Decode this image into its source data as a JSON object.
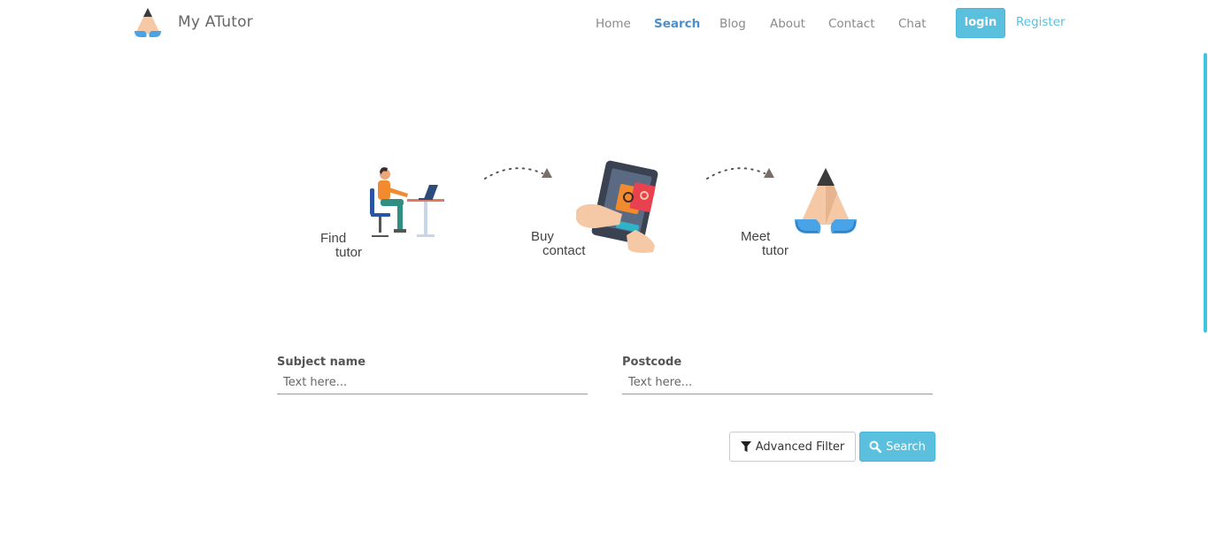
{
  "brand": {
    "name": "My ATutor",
    "logo_icon": "atutor-pencil-logo-icon"
  },
  "nav": {
    "items": [
      {
        "label": "Home",
        "active": false
      },
      {
        "label": "Search",
        "active": true
      },
      {
        "label": "Blog",
        "active": false
      },
      {
        "label": "About",
        "active": false
      },
      {
        "label": "Contact",
        "active": false
      },
      {
        "label": "Chat",
        "active": false
      }
    ],
    "login_label": "login",
    "register_label": "Register"
  },
  "steps": [
    {
      "line1": "Find",
      "line2": "tutor",
      "icon": "person-at-desk-icon"
    },
    {
      "line1": "Buy",
      "line2": "contact",
      "icon": "tablet-contact-icon"
    },
    {
      "line1": "Meet",
      "line2": "tutor",
      "icon": "atutor-logo-icon"
    }
  ],
  "form": {
    "subject_label": "Subject name",
    "subject_placeholder": "Text here...",
    "postcode_label": "Postcode",
    "postcode_placeholder": "Text here...",
    "advanced_filter_label": "Advanced Filter",
    "search_label": "Search"
  },
  "colors": {
    "accent": "#5bc0de",
    "nav_active": "#4d8ec9",
    "scrollbar": "#3ec6e0"
  }
}
